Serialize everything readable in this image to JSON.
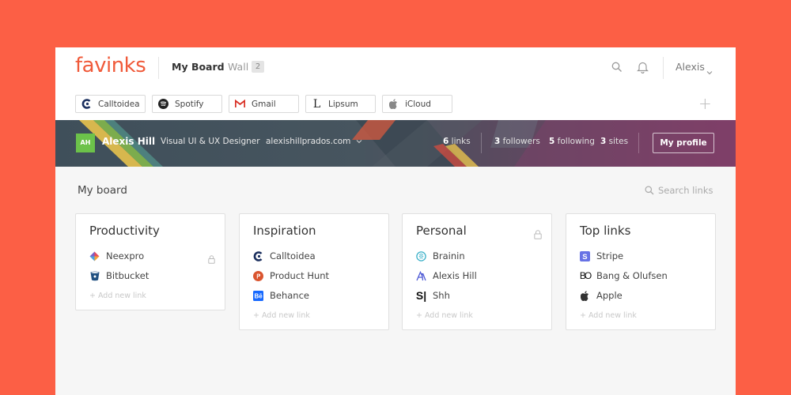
{
  "brand": {
    "logo": "favinks",
    "accent": "#f05a3a",
    "background": "#fc5f45"
  },
  "nav": {
    "my_board": "My Board",
    "wall": "Wall",
    "wall_count": "2"
  },
  "header": {
    "search_icon": "search-icon",
    "bell_icon": "bell-icon",
    "user": "Alexis"
  },
  "bookmarks": [
    {
      "label": "Calltoidea",
      "icon": "calltoidea-icon"
    },
    {
      "label": "Spotify",
      "icon": "spotify-icon"
    },
    {
      "label": "Gmail",
      "icon": "gmail-icon"
    },
    {
      "label": "Lipsum",
      "icon": "lipsum-icon"
    },
    {
      "label": "iCloud",
      "icon": "apple-icon"
    }
  ],
  "add_bookmark": "+",
  "profile": {
    "initials": "AH",
    "name": "Alexis Hill",
    "title": "Visual UI & UX Designer",
    "site": "alexishillprados.com",
    "links_count": "6",
    "links_label": "links",
    "followers_count": "3",
    "followers_label": "followers",
    "following_count": "5",
    "following_label": "following",
    "sites_count": "3",
    "sites_label": "sites",
    "button": "My profile"
  },
  "board": {
    "title": "My board",
    "search_placeholder": "Search links",
    "cards": [
      {
        "title": "Productivity",
        "locked": false,
        "links": [
          {
            "label": "Neexpro",
            "icon": "neexpro-icon",
            "locked": true
          },
          {
            "label": "Bitbucket",
            "icon": "bitbucket-icon"
          }
        ],
        "add": "+ Add new link"
      },
      {
        "title": "Inspiration",
        "locked": false,
        "links": [
          {
            "label": "Calltoidea",
            "icon": "calltoidea-icon"
          },
          {
            "label": "Product Hunt",
            "icon": "producthunt-icon"
          },
          {
            "label": "Behance",
            "icon": "behance-icon"
          }
        ],
        "add": "+ Add new link"
      },
      {
        "title": "Personal",
        "locked": true,
        "links": [
          {
            "label": "Brainin",
            "icon": "brainin-icon"
          },
          {
            "label": "Alexis Hill",
            "icon": "alexis-icon"
          },
          {
            "label": "Shh",
            "icon": "shh-icon"
          }
        ],
        "add": "+ Add new link"
      },
      {
        "title": "Top links",
        "locked": false,
        "links": [
          {
            "label": "Stripe",
            "icon": "stripe-icon"
          },
          {
            "label": "Bang & Olufsen",
            "icon": "bang-olufsen-icon"
          },
          {
            "label": "Apple",
            "icon": "apple-icon"
          }
        ],
        "add": "+ Add new link"
      }
    ]
  }
}
